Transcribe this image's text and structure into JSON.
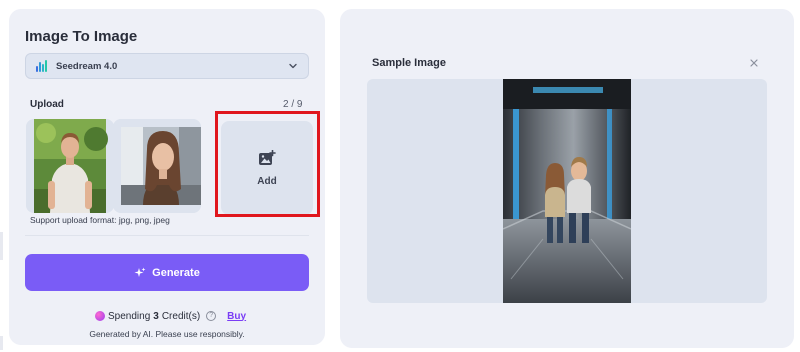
{
  "left_panel": {
    "title": "Image To Image",
    "model_select": {
      "selected": "Seedream 4.0",
      "icon": "seedream-bars-icon"
    },
    "upload": {
      "label": "Upload",
      "count": "2 / 9",
      "thumbnails": [
        {
          "alt": "man-in-park-photo"
        },
        {
          "alt": "woman-portrait-photo"
        }
      ],
      "add_label": "Add",
      "format_note": "Support upload format: jpg, png, jpeg"
    },
    "generate_label": "Generate",
    "spending": {
      "prefix": "Spending",
      "credits": "3",
      "suffix": "Credit(s)",
      "buy_label": "Buy"
    },
    "disclaimer": "Generated by AI. Please use responsibly."
  },
  "right_panel": {
    "title": "Sample Image",
    "close_icon": "close-icon",
    "preview_alt": "couple-in-elevator-photo"
  },
  "colors": {
    "accent": "#7a5cf6",
    "highlight": "#e0161d",
    "panel_bg": "#eef0f7",
    "buy_link": "#7a3df5"
  }
}
